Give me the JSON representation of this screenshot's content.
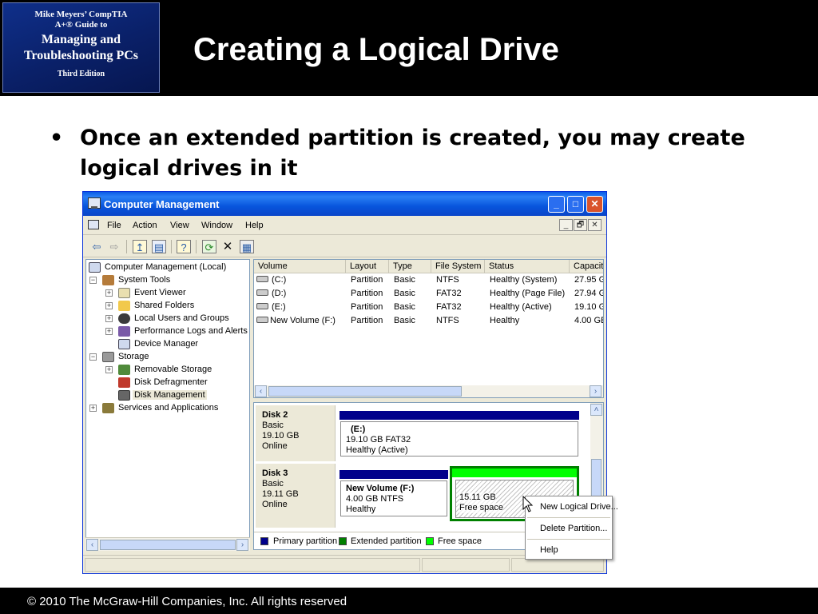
{
  "book": {
    "line1": "Mike Meyers’ CompTIA",
    "line2": "A+® Guide to",
    "line3": "Managing and",
    "line4": "Troubleshooting PCs",
    "edition": "Third Edition"
  },
  "slide": {
    "title": "Creating a Logical Drive",
    "bullet_marker": "•",
    "bullet": "Once an extended partition is created, you may create logical drives in it"
  },
  "window": {
    "title": "Computer Management",
    "controls": {
      "minimize": "_",
      "maximize": "□",
      "close": "✕"
    },
    "menu": [
      "File",
      "Action",
      "View",
      "Window",
      "Help"
    ],
    "mdi_controls": [
      "_",
      "🗗",
      "✕"
    ]
  },
  "tree": {
    "root": "Computer Management (Local)",
    "system_tools": "System Tools",
    "event_viewer": "Event Viewer",
    "shared_folders": "Shared Folders",
    "local_users": "Local Users and Groups",
    "perf_logs": "Performance Logs and Alerts",
    "device_manager": "Device Manager",
    "storage": "Storage",
    "removable_storage": "Removable Storage",
    "disk_defrag": "Disk Defragmenter",
    "disk_management": "Disk Management",
    "services_apps": "Services and Applications"
  },
  "volumes": {
    "headers": [
      "Volume",
      "Layout",
      "Type",
      "File System",
      "Status",
      "Capacit"
    ],
    "rows": [
      [
        "(C:)",
        "Partition",
        "Basic",
        "NTFS",
        "Healthy (System)",
        "27.95 G"
      ],
      [
        "(D:)",
        "Partition",
        "Basic",
        "FAT32",
        "Healthy (Page File)",
        "27.94 G"
      ],
      [
        "(E:)",
        "Partition",
        "Basic",
        "FAT32",
        "Healthy (Active)",
        "19.10 G"
      ],
      [
        "New Volume (F:)",
        "Partition",
        "Basic",
        "NTFS",
        "Healthy",
        "4.00 GE"
      ]
    ]
  },
  "disks": {
    "disk2": {
      "name": "Disk 2",
      "type": "Basic",
      "size": "19.10 GB",
      "status": "Online",
      "vol_name": "(E:)",
      "vol_size": "19.10 GB FAT32",
      "vol_status": "Healthy (Active)"
    },
    "disk3": {
      "name": "Disk 3",
      "type": "Basic",
      "size": "19.11 GB",
      "status": "Online",
      "vol_name": "New Volume  (F:)",
      "vol_size": "4.00 GB NTFS",
      "vol_status": "Healthy",
      "free_size": "15.11 GB",
      "free_label": "Free space"
    }
  },
  "legend": {
    "primary": "Primary partition",
    "extended": "Extended partition",
    "free": "Free space"
  },
  "context_menu": {
    "new_logical": "New Logical Drive...",
    "delete": "Delete Partition...",
    "help": "Help"
  },
  "colors": {
    "primary": "#00008b",
    "extended": "#008000",
    "free": "#00ff00"
  },
  "footer": {
    "copyright": "© 2010 The McGraw-Hill Companies, Inc. All rights reserved"
  }
}
